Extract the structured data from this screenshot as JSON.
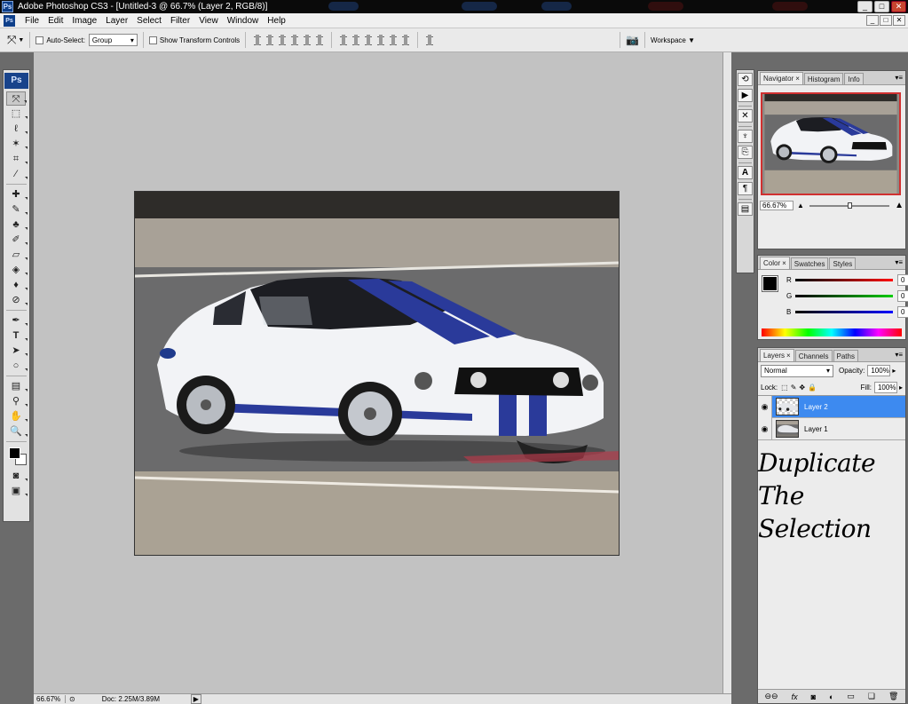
{
  "app": {
    "title": "Adobe Photoshop CS3 - [Untitled-3 @ 66.7% (Layer 2, RGB/8)]",
    "logo": "Ps"
  },
  "menu": [
    "File",
    "Edit",
    "Image",
    "Layer",
    "Select",
    "Filter",
    "View",
    "Window",
    "Help"
  ],
  "options": {
    "auto_select_label": "Auto-Select:",
    "auto_select_value": "Group",
    "show_transform_label": "Show Transform Controls",
    "workspace_label": "Workspace ▼"
  },
  "status": {
    "zoom": "66.67%",
    "doc": "Doc: 2.25M/3.89M"
  },
  "navigator": {
    "tabs": [
      "Navigator",
      "Histogram",
      "Info"
    ],
    "zoom": "66.67%"
  },
  "color": {
    "tabs": [
      "Color",
      "Swatches",
      "Styles"
    ],
    "channels": [
      {
        "label": "R",
        "value": "0"
      },
      {
        "label": "G",
        "value": "0"
      },
      {
        "label": "B",
        "value": "0"
      }
    ]
  },
  "layers": {
    "tabs": [
      "Layers",
      "Channels",
      "Paths"
    ],
    "blend_mode": "Normal",
    "opacity_label": "Opacity:",
    "opacity": "100%",
    "lock_label": "Lock:",
    "fill_label": "Fill:",
    "fill": "100%",
    "items": [
      {
        "name": "Layer 2",
        "active": true
      },
      {
        "name": "Layer 1",
        "active": false
      }
    ]
  },
  "annotation": {
    "line1": "Duplicate The",
    "line2": "Selection"
  },
  "window": {
    "minimize": "_",
    "maximize": "□",
    "close": "✕"
  },
  "colors": {
    "selection": "#3d8af0",
    "navigator_frame": "#d03030",
    "stripe_blue": "#2a3a9a"
  }
}
